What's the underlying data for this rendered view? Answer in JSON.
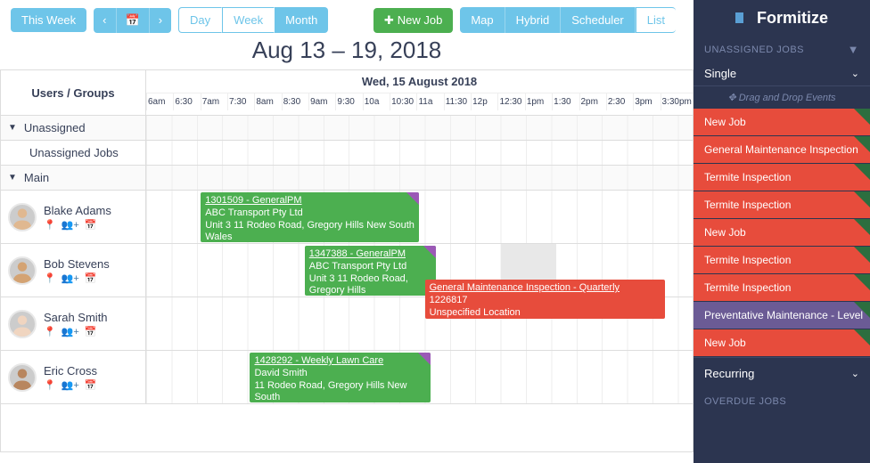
{
  "toolbar": {
    "thisWeek": "This Week",
    "views": [
      "Day",
      "Week",
      "Month"
    ],
    "newJob": "New Job",
    "modes": [
      "Map",
      "Hybrid",
      "Scheduler",
      "List"
    ]
  },
  "rangeTitle": "Aug 13 – 19, 2018",
  "calendar": {
    "usersGroupsLabel": "Users / Groups",
    "dayLabel": "Wed, 15 August 2018",
    "timeSlots": [
      "6am",
      "6:30",
      "7am",
      "7:30",
      "8am",
      "8:30",
      "9am",
      "9:30",
      "10a",
      "10:30",
      "11a",
      "11:30",
      "12p",
      "12:30",
      "1pm",
      "1:30",
      "2pm",
      "2:30",
      "3pm",
      "3:30pm"
    ],
    "groups": [
      {
        "name": "Unassigned",
        "rows": [
          {
            "label": "Unassigned Jobs"
          }
        ]
      },
      {
        "name": "Main",
        "rows": [
          {
            "user": "Blake Adams"
          },
          {
            "user": "Bob Stevens"
          },
          {
            "user": "Sarah Smith"
          },
          {
            "user": "Eric Cross"
          }
        ]
      }
    ],
    "jobs": [
      {
        "id": "j1",
        "line1": "1301509 - GeneralPM",
        "line2": "ABC Transport Pty Ltd",
        "line3": "Unit 3 11 Rodeo Road, Gregory Hills New South Wales"
      },
      {
        "id": "j2",
        "line1": "1347388 - GeneralPM",
        "line2": "ABC Transport Pty Ltd",
        "line3": "Unit 3 11 Rodeo Road, Gregory Hills"
      },
      {
        "id": "j3",
        "line1": "General Maintenance Inspection - Quarterly",
        "line2": "1226817",
        "line3": "Unspecified Location"
      },
      {
        "id": "j4",
        "line1": "1428292 - Weekly Lawn Care",
        "line2": "David Smith",
        "line3": "11 Rodeo Road, Gregory Hills New South"
      }
    ]
  },
  "side": {
    "brand": "Formitize",
    "unassignedLabel": "UNASSIGNED JOBS",
    "selectLabel": "Single",
    "dragHint": "Drag and Drop Events",
    "items": [
      {
        "label": "New Job"
      },
      {
        "label": "General Maintenance Inspection"
      },
      {
        "label": "Termite Inspection"
      },
      {
        "label": "Termite Inspection"
      },
      {
        "label": "New Job"
      },
      {
        "label": "Termite Inspection"
      },
      {
        "label": "Termite Inspection"
      },
      {
        "label": "Preventative Maintenance - Level",
        "purple": true
      },
      {
        "label": "New Job"
      }
    ],
    "recurringLabel": "Recurring",
    "overdueLabel": "OVERDUE JOBS"
  }
}
